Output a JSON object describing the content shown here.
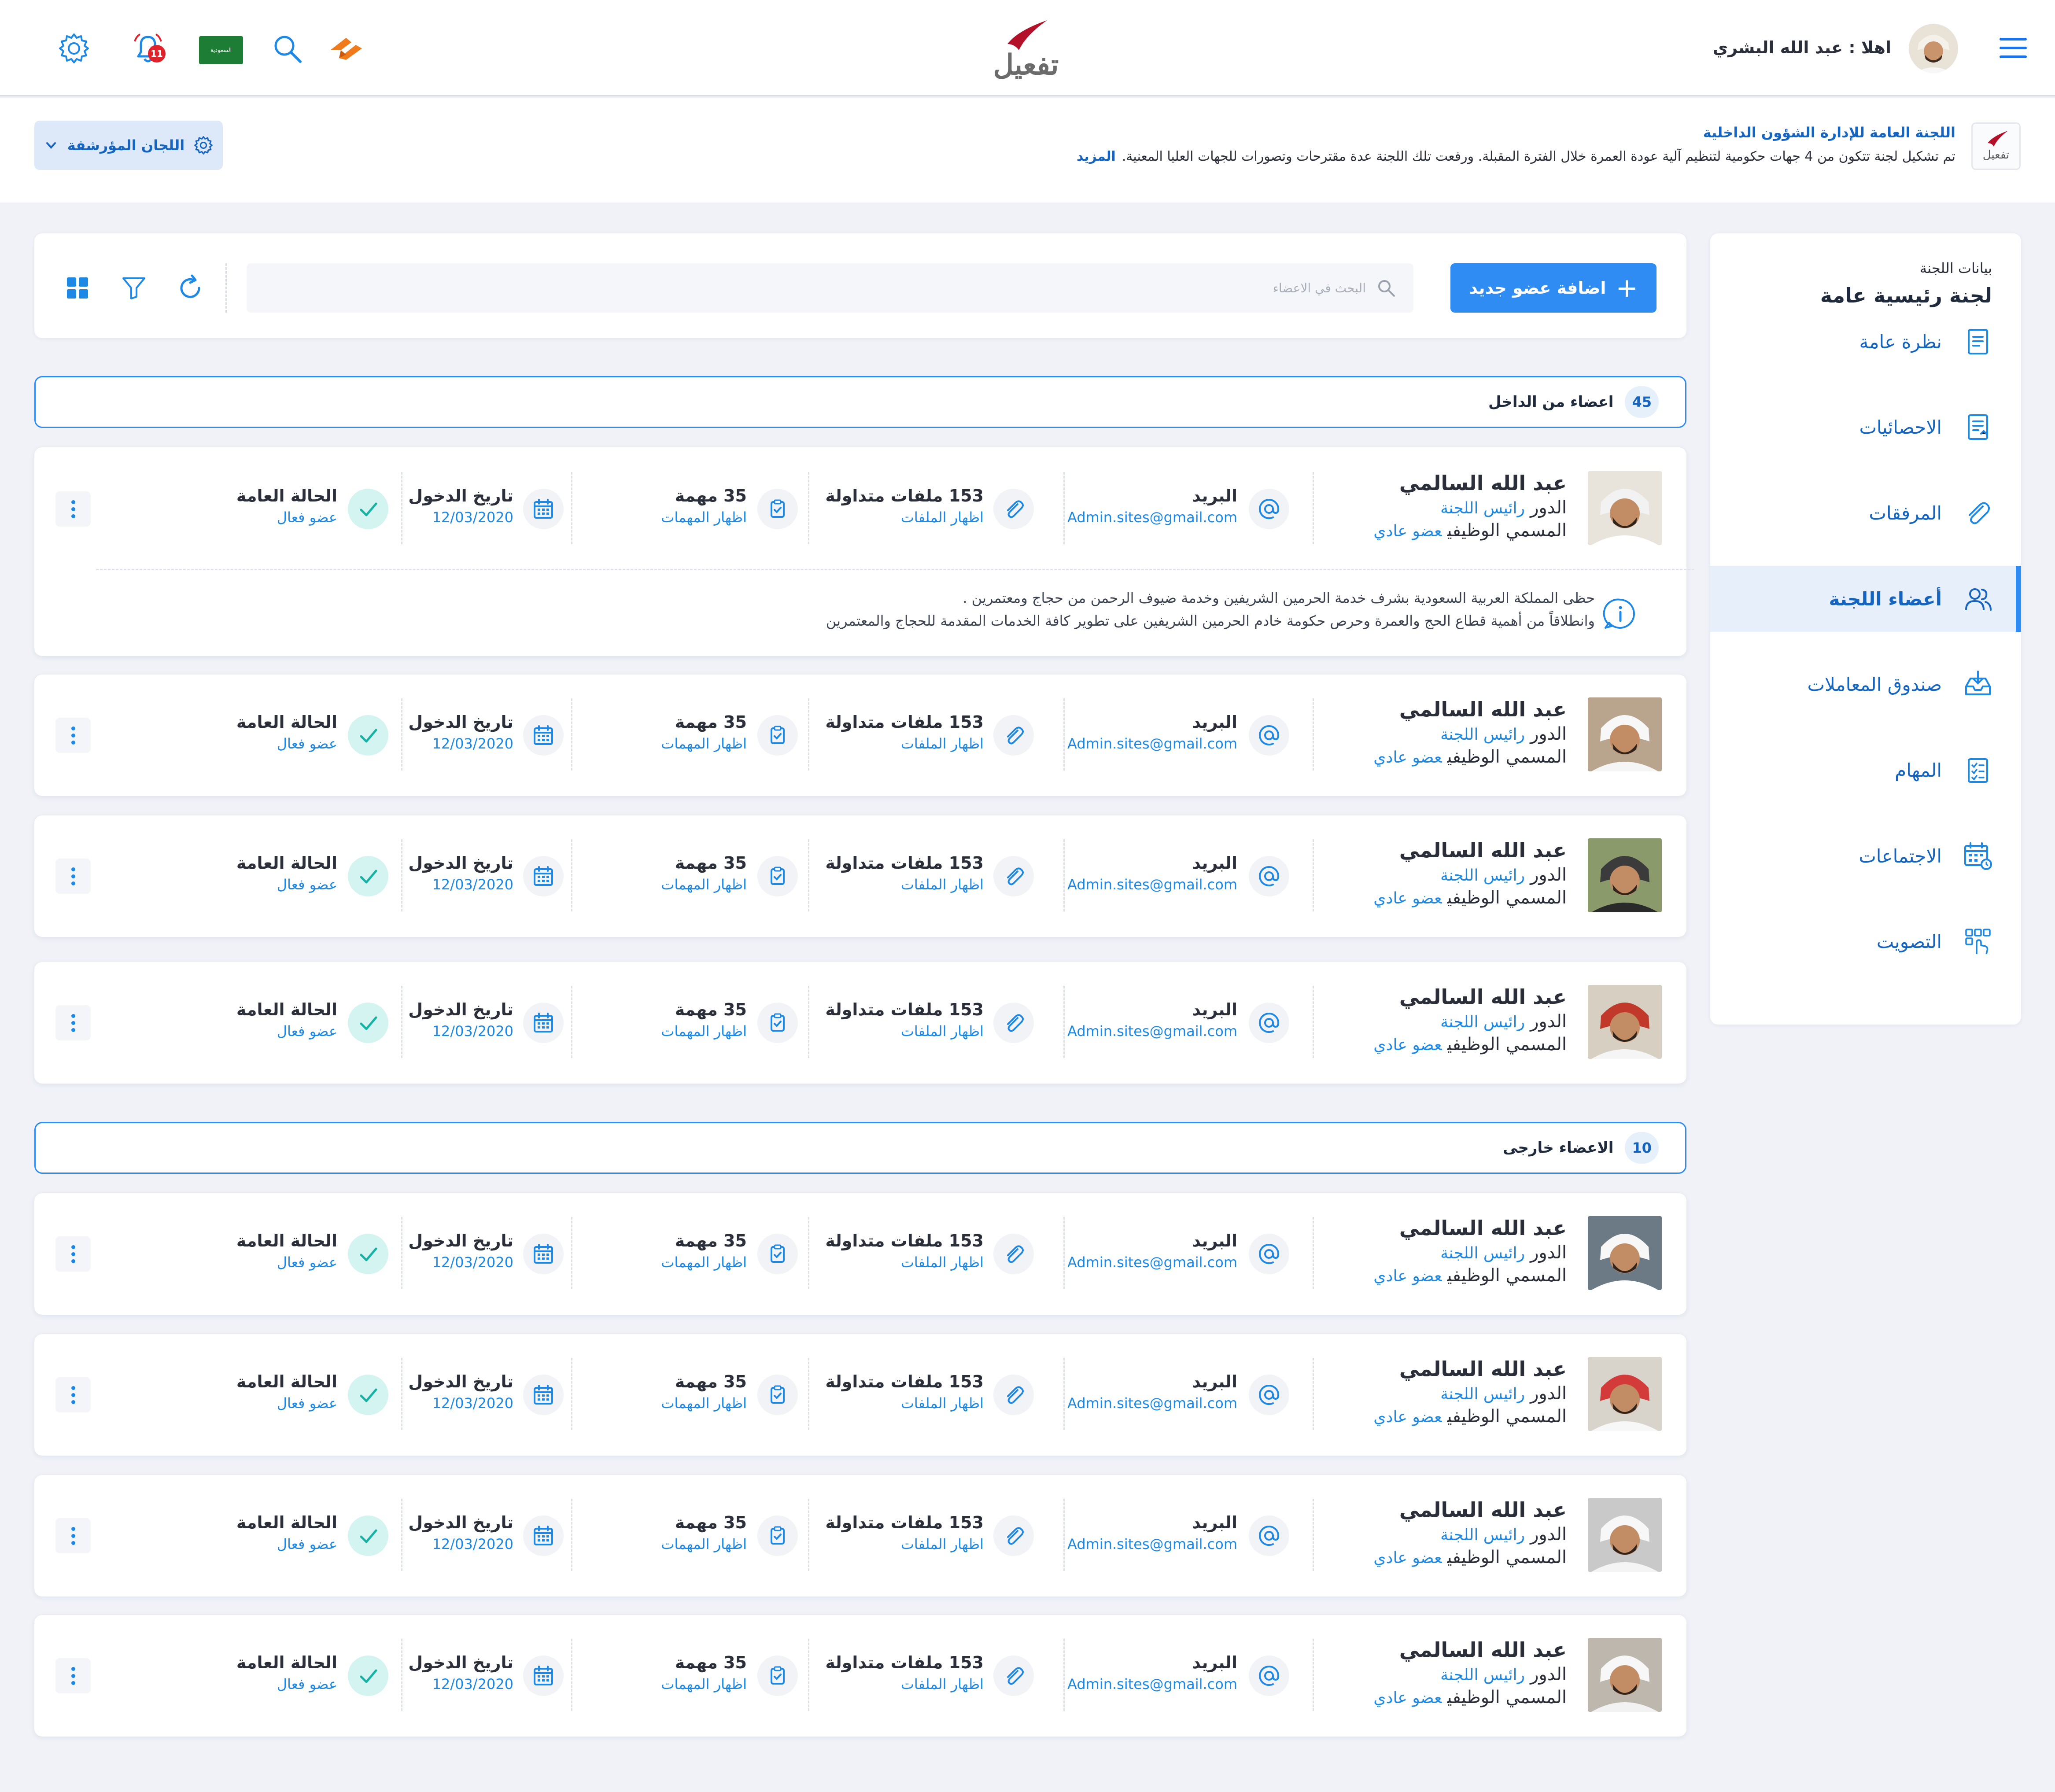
{
  "header": {
    "greeting": "اهلا : عبد الله البشري",
    "logo_text": "تفعيل",
    "notification_count": "11",
    "flag_text": "السعودية"
  },
  "committee": {
    "logo_text": "تفعيل",
    "title": "اللجنة العامة للإدارة الشؤون الداخلية",
    "description": "تم تشكيل لجنة تتكون من 4 جهات حكومية لتنظيم آلية عودة العمرة خلال الفترة المقبلة. ورفعت تلك اللجنة عدة مقترحات وتصورات للجهات العليا المعنية.",
    "more": "المزيد",
    "archived_label": "اللجان المؤرشفة"
  },
  "toolbar": {
    "add_member": "اضافة عضو جديد",
    "search_placeholder": "البحث في الاعضاء"
  },
  "sidebar": {
    "label": "بيانات اللجنة",
    "title": "لجنة رئيسية عامة",
    "items": [
      {
        "label": "نظرة عامة",
        "icon": "document-icon"
      },
      {
        "label": "الاحصائيات",
        "icon": "stats-icon"
      },
      {
        "label": "المرفقات",
        "icon": "attachment-icon"
      },
      {
        "label": "أعضاء اللجنة",
        "icon": "users-icon"
      },
      {
        "label": "صندوق المعاملات",
        "icon": "inbox-icon"
      },
      {
        "label": "المهام",
        "icon": "checklist-icon"
      },
      {
        "label": "الاجتماعات",
        "icon": "calendar-icon"
      },
      {
        "label": "التصويت",
        "icon": "vote-icon"
      }
    ]
  },
  "sections": {
    "internal": {
      "count": "45",
      "title": "اعضاء من الداخل"
    },
    "external": {
      "count": "10",
      "title": "الاعضاء خارجى"
    }
  },
  "member": {
    "name": "عبد الله السالمي",
    "role_label": "الدور",
    "role_value": "رائيس اللجنة",
    "job_label": "المسمي الوظيفي",
    "job_value": "عضو عادي",
    "email_label": "البريد",
    "email_value": "Admin.sites@gmail.com",
    "files_title": "153 ملفات متداولة",
    "files_link": "اظهار الملفات",
    "tasks_title": "35 مهمة",
    "tasks_link": "اظهار المهمات",
    "date_label": "تاريخ الدخول",
    "date_value": "12/03/2020",
    "status_label": "الحالة العامة",
    "status_value": "عضو فعال"
  },
  "note": {
    "line1": "حظى المملكة العربية السعودية بشرف خدمة الحرمين الشريفين وخدمة ضيوف الرحمن من حجاج ومعتمرين .",
    "line2": "وانطلاقاً من أهمية قطاع الحج والعمرة وحرص حكومة خادم الحرمين الشريفين على تطوير كافة الخدمات المقدمة للحجاج والمعتمرين"
  },
  "colors": {
    "primary": "#2f8cf3",
    "link": "#1e88e5",
    "active_bg": "#e6effa",
    "success_bg": "#d3f4f1",
    "success": "#16b3a4",
    "badge": "#e0222a"
  }
}
